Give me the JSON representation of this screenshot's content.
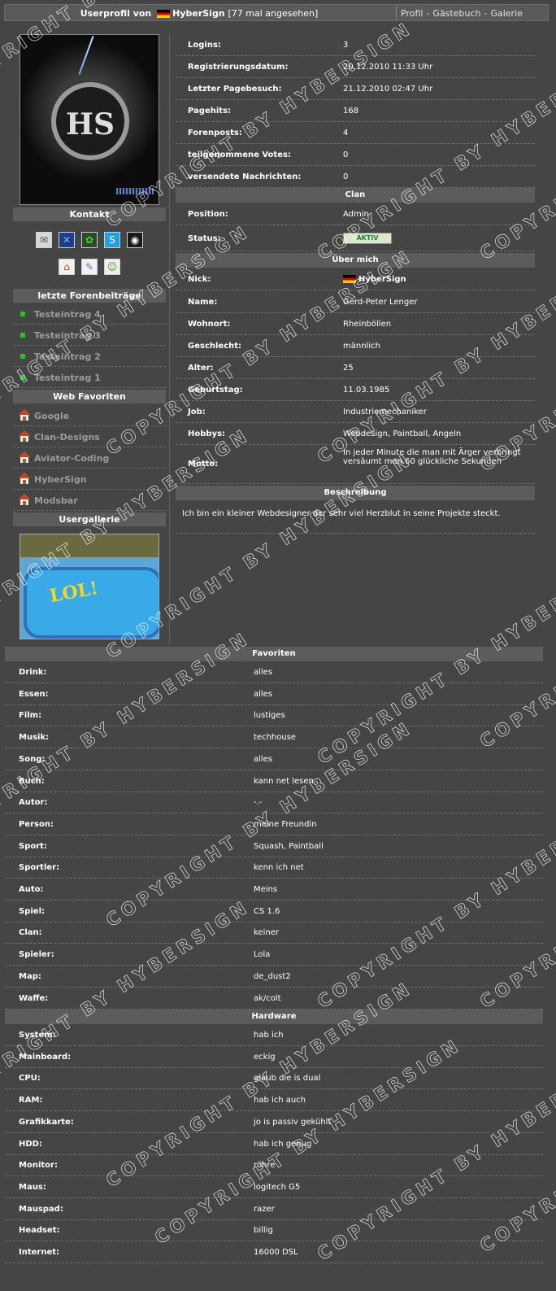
{
  "header": {
    "title_prefix": "Userprofil von",
    "username": "HyberSign",
    "views": "[77 mal angesehen]",
    "nav": [
      "Profil",
      "Gästebuch",
      "Galerie"
    ]
  },
  "left": {
    "contact_title": "Kontakt",
    "contact_icons": [
      "mail-icon",
      "msn-icon",
      "icq-icon",
      "skype-icon",
      "steam-icon",
      "homepage-icon",
      "guestbook-icon",
      "buddy-add-icon"
    ],
    "forum_title": "letzte Forenbeiträge",
    "forum_posts": [
      "Testeintrag 4",
      "Testeintrag 3",
      "Testeintrag 2",
      "Testeintrag 1"
    ],
    "favorites_title": "Web Favoriten",
    "web_favorites": [
      "Google",
      "Clan-Designs",
      "Aviator-Coding",
      "HyberSign",
      "Modsbar"
    ],
    "gallery_title": "Usergallerie",
    "gallery_caption": "LOL!"
  },
  "stats": [
    {
      "label": "Logins:",
      "value": "3"
    },
    {
      "label": "Registrierungsdatum:",
      "value": "20.12.2010 11:33 Uhr"
    },
    {
      "label": "Letzter Pagebesuch:",
      "value": "21.12.2010 02:47 Uhr"
    },
    {
      "label": "Pagehits:",
      "value": "168"
    },
    {
      "label": "Forenposts:",
      "value": "4"
    },
    {
      "label": "teilgenommene Votes:",
      "value": "0"
    },
    {
      "label": "versendete Nachrichten:",
      "value": "0"
    }
  ],
  "clan": {
    "title": "Clan",
    "position_label": "Position:",
    "position_value": "Admin",
    "status_label": "Status:",
    "status_value": "AKTIV"
  },
  "about": {
    "title": "Über mich",
    "nick_label": "Nick:",
    "nick_value": "HyberSign",
    "rows": [
      {
        "label": "Name:",
        "value": "Gerd-Peter Lenger"
      },
      {
        "label": "Wohnort:",
        "value": "Rheinböllen"
      },
      {
        "label": "Geschlecht:",
        "value": "männlich"
      },
      {
        "label": "Alter:",
        "value": "25"
      },
      {
        "label": "Geburtstag:",
        "value": "11.03.1985"
      },
      {
        "label": "Job:",
        "value": "Industriemechaniker"
      },
      {
        "label": "Hobbys:",
        "value": "Webdesign, Paintball, Angeln"
      }
    ],
    "motto_label": "Motto:",
    "motto_value": "In jeder Minute die man mit Ärger verbringt versäumt man 60 glückliche Sekunden"
  },
  "description": {
    "title": "Beschreibung",
    "text": "Ich bin ein kleiner Webdesigner der sehr viel Herzblut in seine Projekte steckt."
  },
  "favoriten": {
    "title": "Favoriten",
    "rows": [
      {
        "label": "Drink:",
        "value": "alles"
      },
      {
        "label": "Essen:",
        "value": "alles"
      },
      {
        "label": "Film:",
        "value": "lustiges"
      },
      {
        "label": "Musik:",
        "value": "techhouse"
      },
      {
        "label": "Song:",
        "value": "alles"
      },
      {
        "label": "Buch:",
        "value": "kann net lesen"
      },
      {
        "label": "Autor:",
        "value": "-.-"
      },
      {
        "label": "Person:",
        "value": "meine Freundin"
      },
      {
        "label": "Sport:",
        "value": "Squash, Paintball"
      },
      {
        "label": "Sportler:",
        "value": "kenn ich net"
      },
      {
        "label": "Auto:",
        "value": "Meins"
      },
      {
        "label": "Spiel:",
        "value": "CS 1.6"
      },
      {
        "label": "Clan:",
        "value": "keiner"
      },
      {
        "label": "Spieler:",
        "value": "Lola"
      },
      {
        "label": "Map:",
        "value": "de_dust2"
      },
      {
        "label": "Waffe:",
        "value": "ak/colt"
      }
    ]
  },
  "hardware": {
    "title": "Hardware",
    "rows": [
      {
        "label": "System:",
        "value": "hab ich"
      },
      {
        "label": "Mainboard:",
        "value": "eckig"
      },
      {
        "label": "CPU:",
        "value": "glaub die is dual"
      },
      {
        "label": "RAM:",
        "value": "hab ich auch"
      },
      {
        "label": "Grafikkarte:",
        "value": "jo is passiv gekühlt"
      },
      {
        "label": "HDD:",
        "value": "hab ich genug"
      },
      {
        "label": "Monitor:",
        "value": "röhre"
      },
      {
        "label": "Maus:",
        "value": "logitech G5"
      },
      {
        "label": "Mauspad:",
        "value": "razer"
      },
      {
        "label": "Headset:",
        "value": "billig"
      },
      {
        "label": "Internet:",
        "value": "16000 DSL"
      }
    ]
  },
  "watermark": "COPYRIGHT BY HYBERSIGN",
  "colors": {
    "background": "#454545",
    "header": "#5c5c5c",
    "online_green": "#2ec02e"
  }
}
